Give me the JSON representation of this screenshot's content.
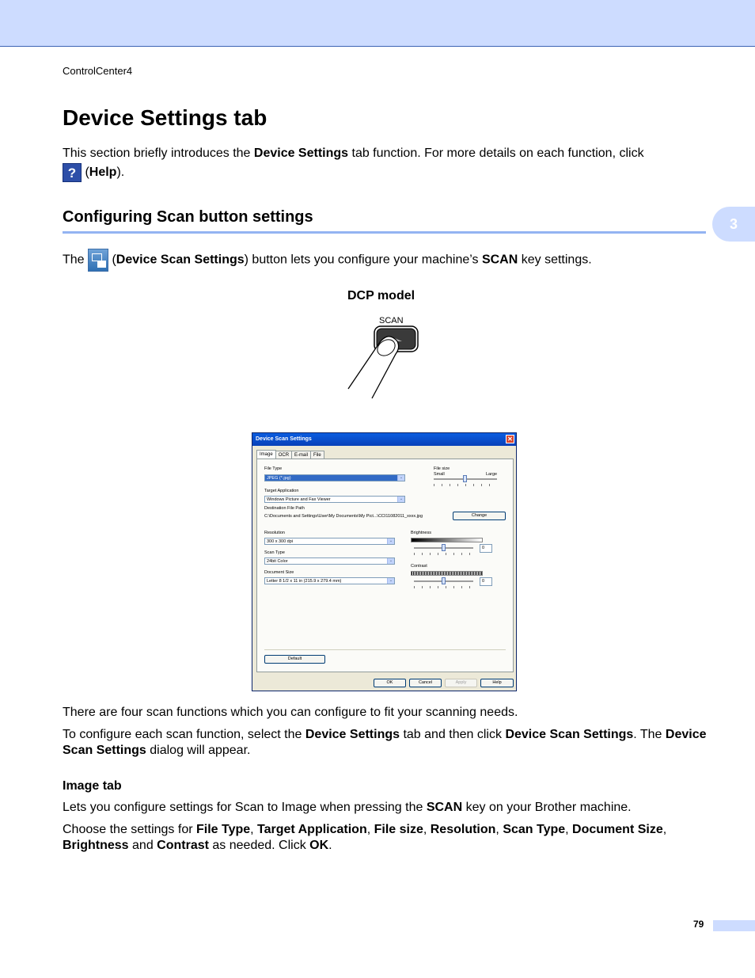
{
  "header": {
    "running_title": "ControlCenter4"
  },
  "page_title": "Device Settings tab",
  "intro": {
    "prefix": "This section briefly introduces the ",
    "bold1": "Device Settings",
    "middle": " tab function. For more details on each function, click",
    "help_icon_glyph": "?",
    "help_open": " (",
    "help_bold": "Help",
    "help_close": ")."
  },
  "section": {
    "title": "Configuring Scan button settings",
    "chapter_number": "3"
  },
  "scan_para": {
    "prefix": "The ",
    "paren_open": " (",
    "bold1": "Device Scan Settings",
    "middle": ") button lets you configure your machine’s ",
    "bold2": "SCAN",
    "suffix": " key settings."
  },
  "figure": {
    "caption": "DCP model",
    "key_label": "SCAN"
  },
  "dialog": {
    "title": "Device Scan Settings",
    "close_glyph": "✕",
    "tabs": [
      "Image",
      "OCR",
      "E-mail",
      "File"
    ],
    "file_type_label": "File Type",
    "file_type_value": "JPEG (*.jpg)",
    "file_size_label": "File size",
    "file_size_small": "Small",
    "file_size_large": "Large",
    "target_app_label": "Target Application",
    "target_app_value": "Windows Picture and Fax Viewer",
    "dest_path_label": "Destination File Path",
    "dest_path_value": "C:\\Documents and Settings\\User\\My Documents\\My Pict...\\CCI11082011_xxxx.jpg",
    "change_button": "Change",
    "resolution_label": "Resolution",
    "resolution_value": "300 x 300 dpi",
    "scan_type_label": "Scan Type",
    "scan_type_value": "24bit Color",
    "doc_size_label": "Document Size",
    "doc_size_value": "Letter 8 1/2 x 11 in (215.9 x 279.4 mm)",
    "brightness_label": "Brightness",
    "brightness_value": "0",
    "contrast_label": "Contrast",
    "contrast_value": "0",
    "default_button": "Default",
    "ok_button": "OK",
    "cancel_button": "Cancel",
    "apply_button": "Apply",
    "help_button": "Help",
    "arrow_glyph": "⌄"
  },
  "body": {
    "p1": "There are four scan functions which you can configure to fit your scanning needs.",
    "p2_prefix": "To configure each scan function, select the ",
    "p2_bold1": "Device Settings",
    "p2_mid": " tab and then click ",
    "p2_bold2": "Device Scan Settings",
    "p2_mid2": ". The ",
    "p2_bold3": "Device Scan Settings",
    "p2_suffix": " dialog will appear.",
    "subhead": "Image tab",
    "p3_prefix": "Lets you configure settings for Scan to Image when pressing the ",
    "p3_bold": "SCAN",
    "p3_suffix": " key on your Brother machine.",
    "p4_prefix": "Choose the settings for ",
    "p4_b1": "File Type",
    "p4_c1": ", ",
    "p4_b2": "Target Application",
    "p4_c2": ", ",
    "p4_b3": "File size",
    "p4_c3": ", ",
    "p4_b4": "Resolution",
    "p4_c4": ", ",
    "p4_b5": "Scan Type",
    "p4_c5": ", ",
    "p4_b6": "Document Size",
    "p4_c6": ", ",
    "p4_b7": "Brightness",
    "p4_and": " and ",
    "p4_b8": "Contrast",
    "p4_mid": " as needed. Click ",
    "p4_b9": "OK",
    "p4_end": "."
  },
  "footer": {
    "page_number": "79"
  }
}
